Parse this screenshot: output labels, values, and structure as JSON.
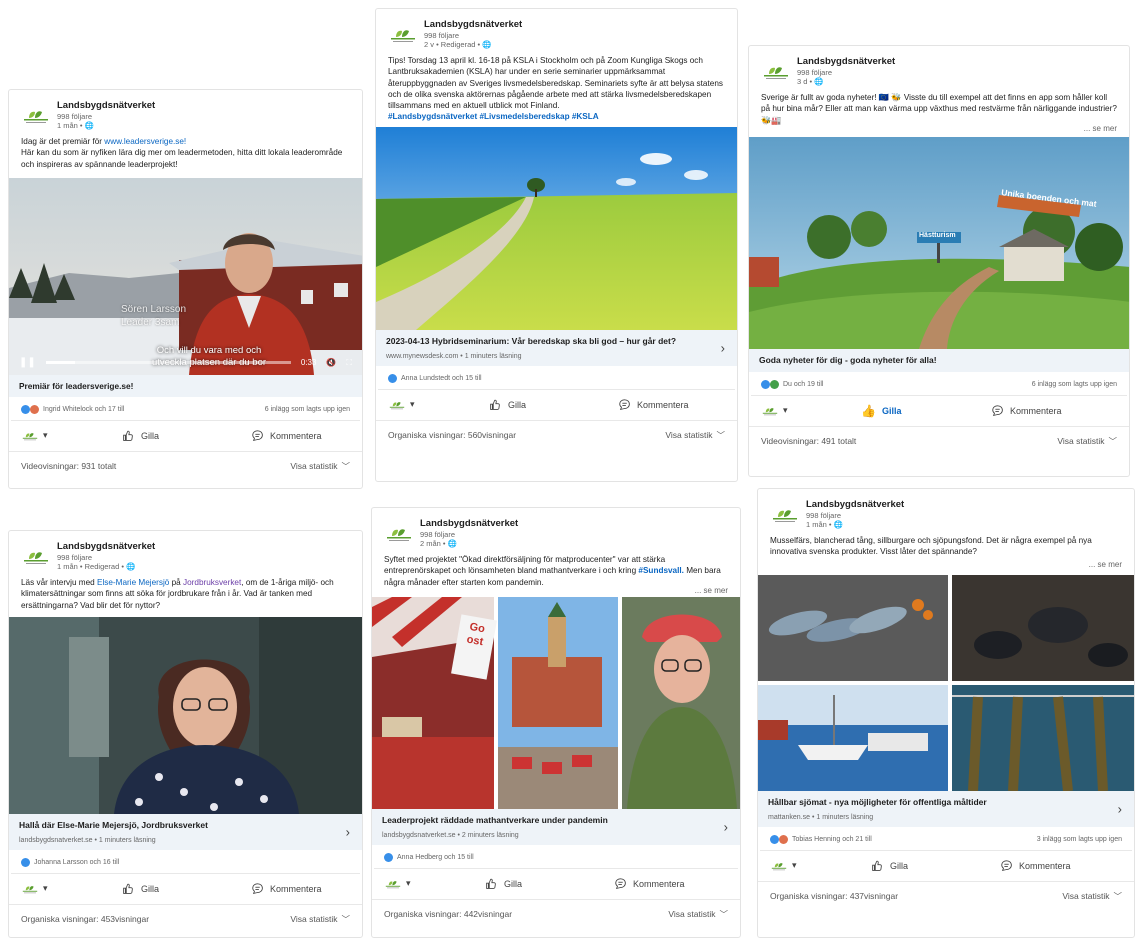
{
  "org": {
    "name": "Landsbygdsnätverket",
    "followers": "998 följare"
  },
  "colors": {
    "link": "#0a66c2",
    "like": "#378fe9",
    "heart": "#df704d",
    "celebrate": "#44a04a"
  },
  "posts": [
    {
      "meta": "1 mån • 🌐",
      "text_pre": "Idag är det premiär för ",
      "text_link": "www.leadersverige.se!",
      "text_post": "Här kan du som är nyfiken lära dig mer om leadermetoden, hitta ditt lokala leaderområde och inspireras av spännande leaderprojekt!",
      "video": {
        "overlay_name": "Sören Larsson",
        "overlay_role": "Leader 3sam",
        "subtitle_1": "Och vill du vara med och",
        "subtitle_2": "utveckla platsen där du bor",
        "time": "0:33",
        "progress": 0.12
      },
      "caption": "Premiär för leadersverige.se!",
      "reactions": "Ingrid Whitelock och 17 till",
      "reposts": "6 inlägg som lagts upp igen",
      "like_label": "Gilla",
      "comment_label": "Kommentera",
      "footer_left": "Videovisningar: 931 totalt",
      "footer_right": "Visa statistik"
    },
    {
      "meta": "2 v • Redigerad • 🌐",
      "text": "Tips! Torsdag 13 april kl. 16-18 på KSLA i Stockholm och på Zoom Kungliga Skogs och Lantbruksakademien (KSLA) har under en serie seminarier uppmärksammat återuppbyggnaden av Sveriges livsmedelsberedskap. Seminariets syfte är att belysa statens och de olika svenska aktörernas pågående arbete med att stärka livsmedelsberedskapen tillsammans med en aktuell utblick mot Finland.",
      "hashtags": "#Landsbygdsnätverket #Livsmedelsberedskap #KSLA",
      "link_title": "2023-04-13 Hybridseminarium: Vår beredskap ska bli god – hur går det?",
      "link_sub": "www.mynewsdesk.com • 1 minuters läsning",
      "reactions": "Anna Lundstedt och 15 till",
      "like_label": "Gilla",
      "comment_label": "Kommentera",
      "footer_left": "Organiska visningar: 560visningar",
      "footer_right": "Visa statistik"
    },
    {
      "meta": "3 d • 🌐",
      "text": "Sverige är fullt av goda nyheter! 🇪🇺 🐝 Visste du till exempel att det finns en app som håller koll på hur bina mår? Eller att man kan värma upp växthus med restvärme från närliggande industrier? 🐝🏭",
      "see_more": "... se mer",
      "sign_1": "Unika boenden och mat",
      "sign_2": "Hästturism",
      "link_title": "Goda nyheter för dig - goda nyheter för alla!",
      "reactions": "Du och 19 till",
      "reposts": "6 inlägg som lagts upp igen",
      "like_label": "Gilla",
      "comment_label": "Kommentera",
      "footer_left": "Videovisningar: 491 totalt",
      "footer_right": "Visa statistik"
    },
    {
      "meta": "1 mån • Redigerad • 🌐",
      "text_1": "Läs vår intervju med ",
      "text_link_1": "Else-Marie Mejersjö",
      "text_2": " på ",
      "text_link_2": "Jordbruksverket",
      "text_3": ", om de 1-åriga miljö- och klimatersättningar som finns att söka för jordbrukare från i år. Vad är tanken med ersättningarna? Vad blir det för nyttor?",
      "link_title": "Hallå där Else-Marie Mejersjö, Jordbruksverket",
      "link_sub": "landsbygdsnatverket.se • 1 minuters läsning",
      "reactions": "Johanna Larsson och 16 till",
      "like_label": "Gilla",
      "comment_label": "Kommentera",
      "footer_left": "Organiska visningar: 453visningar",
      "footer_right": "Visa statistik"
    },
    {
      "meta": "2 mån • 🌐",
      "text_pre": "Syftet med projektet \"Ökad direktförsäljning för matproducenter\" var att stärka entreprenörskapet och lönsamheten bland mathantverkare i och kring ",
      "text_link": "#Sundsvall.",
      "text_post": " Men bara några månader efter starten kom pandemin.",
      "see_more": "... se mer",
      "sign_text": "Go ost",
      "link_title": "Leaderprojekt räddade mathantverkare under pandemin",
      "link_sub": "landsbygdsnatverket.se • 2 minuters läsning",
      "reactions": "Anna Hedberg och 15 till",
      "like_label": "Gilla",
      "comment_label": "Kommentera",
      "footer_left": "Organiska visningar: 442visningar",
      "footer_right": "Visa statistik"
    },
    {
      "meta": "1 mån • 🌐",
      "text": "Musselfärs, blancherad tång, sillburgare och sjöpungsfond. Det är några exempel på nya innovativa svenska produkter. Visst låter det spännande?",
      "see_more": "... se mer",
      "link_title": "Hållbar sjömat - nya möjligheter för offentliga måltider",
      "link_sub": "mattanken.se • 1 minuters läsning",
      "reactions": "Tobias Henning och 21 till",
      "reposts": "3 inlägg som lagts upp igen",
      "like_label": "Gilla",
      "comment_label": "Kommentera",
      "footer_left": "Organiska visningar: 437visningar",
      "footer_right": "Visa statistik"
    }
  ]
}
